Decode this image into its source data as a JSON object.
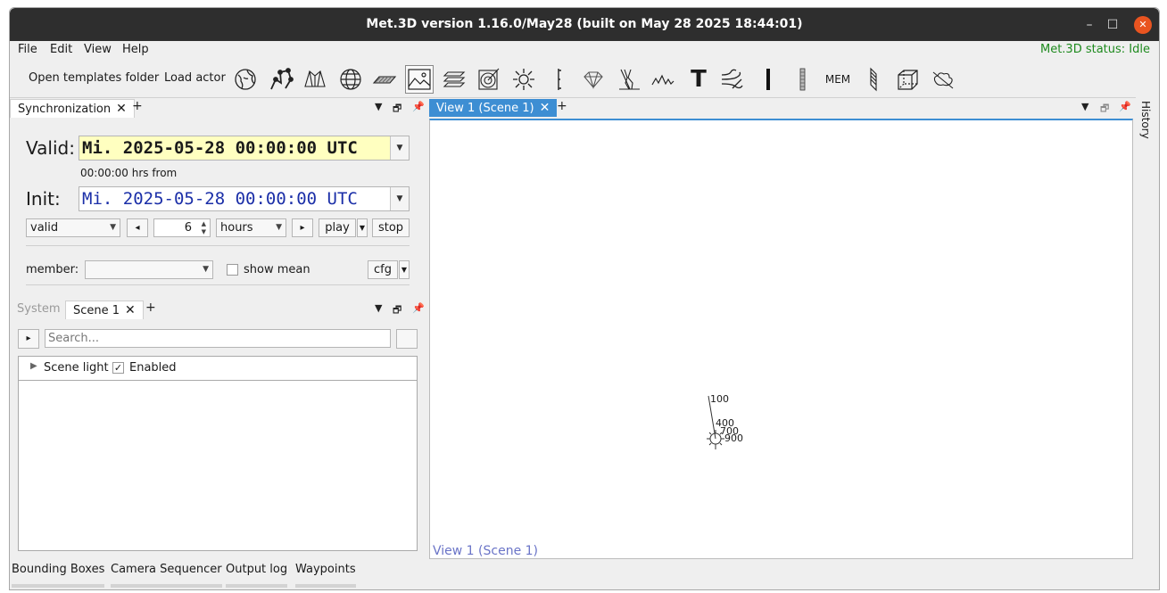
{
  "window": {
    "title": "Met.3D version 1.16.0/May28 (built on May 28 2025 18:44:01)",
    "minimize": "–",
    "maximize": "☐",
    "close": "✕"
  },
  "menu": {
    "items": [
      "File",
      "Edit",
      "View",
      "Help"
    ],
    "status": "Met.3D status: Idle"
  },
  "toolbar": {
    "open_templates": "Open templates folder",
    "load_actor": "Load actor",
    "icons": [
      "globe-grid-icon",
      "trajectory-icon",
      "volume-icon",
      "sphere-grid-icon",
      "horizontal-section-icon",
      "image-icon",
      "multi-section-icon",
      "radar-icon",
      "sun-icon",
      "vertical-bar-icon",
      "diamond-icon",
      "skew-t-icon",
      "peaks-icon",
      "text-icon",
      "wind-icon",
      "black-bar-icon",
      "gray-bar-icon",
      "mem-icon",
      "vertical-section-icon",
      "bounding-box-icon",
      "clouds-icon"
    ],
    "text_icon_label": "T",
    "mem_label": "MEM"
  },
  "sync_dock": {
    "tab_label": "Synchronization",
    "add_tab": "+",
    "valid_label": "Valid:",
    "valid_value": "Mi. 2025-05-28 00:00:00 UTC",
    "offset_text": "00:00:00 hrs from",
    "init_label": "Init:",
    "init_value": "Mi. 2025-05-28 00:00:00 UTC",
    "mode_value": "valid",
    "step_value": "6",
    "unit_value": "hours",
    "play_label": "play",
    "stop_label": "stop",
    "member_label": "member:",
    "show_mean_label": "show mean",
    "cfg_label": "cfg",
    "prev_arrow": "◂",
    "next_arrow": "▸"
  },
  "scene_dock": {
    "system_tab": "System",
    "scene_tab": "Scene 1",
    "add_tab": "+",
    "search_placeholder": "Search...",
    "tree_item": "Scene light",
    "enabled_label": "Enabled",
    "enabled_check": "✓"
  },
  "view": {
    "tab_label": "View 1 (Scene 1)",
    "add_tab": "+",
    "canvas_label": "View 1 (Scene 1)",
    "label_100": "100",
    "label_400": "400",
    "label_700": "700",
    "label_900": "900"
  },
  "right_dock": {
    "history_label": "History"
  },
  "bottom_tabs": [
    "Bounding Boxes",
    "Camera Sequencer",
    "Output log",
    "Waypoints"
  ]
}
